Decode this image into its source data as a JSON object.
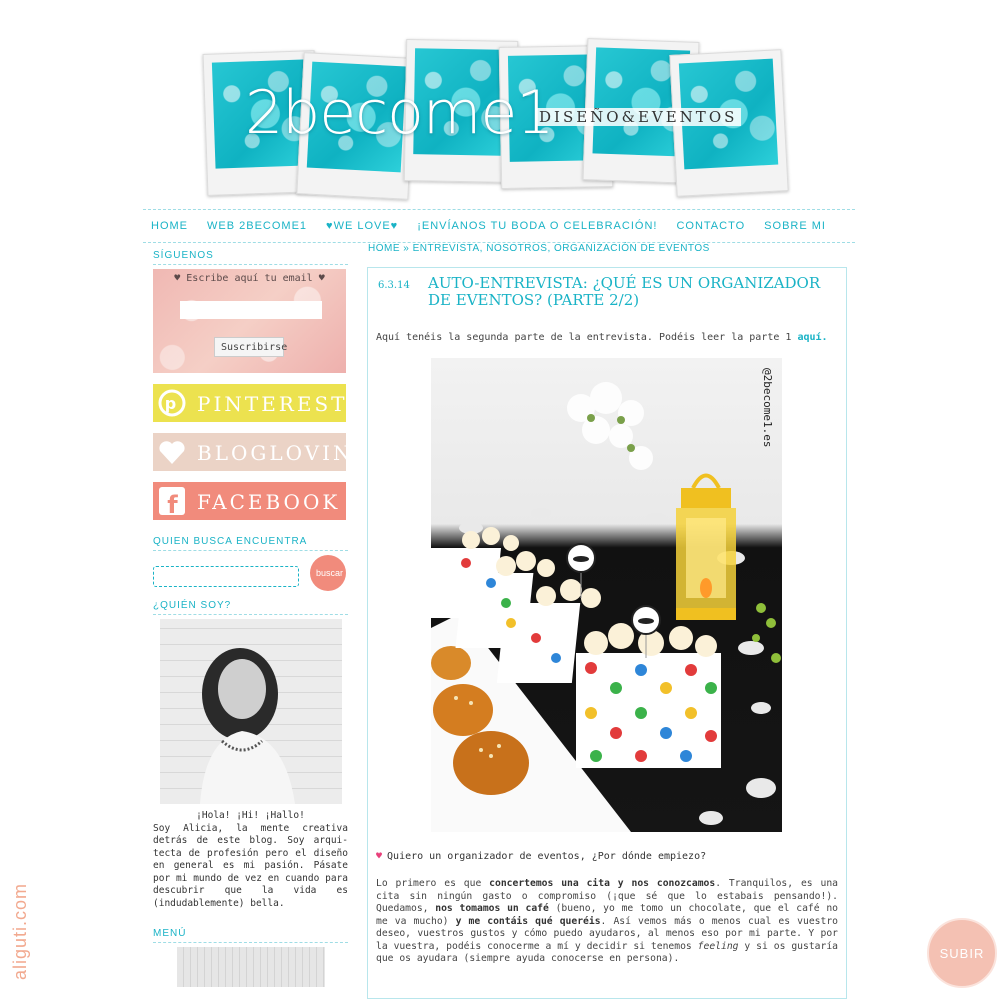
{
  "brand": {
    "logo": "2become1",
    "tagline": "DISEÑO&EVENTOS"
  },
  "nav": [
    {
      "label": "HOME"
    },
    {
      "label": "WEB 2BECOME1"
    },
    {
      "label": "♥WE LOVE♥"
    },
    {
      "label": "¡ENVÍANOS TU BODA O CELEBRACIÓN!"
    },
    {
      "label": "CONTACTO"
    },
    {
      "label": "SOBRE MI"
    }
  ],
  "sidebar": {
    "follow_title": "SÍGUENOS",
    "subscribe_label": "♥ Escribe aquí tu email ♥",
    "subscribe_button": "Suscribirse",
    "social": [
      {
        "label": "PINTEREST",
        "icon": "pinterest-icon",
        "color": "#ece24f"
      },
      {
        "label": "BLOGLOVIN",
        "icon": "heart-icon",
        "color": "#ebd3c6"
      },
      {
        "label": "FACEBOOK",
        "icon": "facebook-icon",
        "color": "#f18b7c"
      }
    ],
    "search_title": "QUIEN BUSCA ENCUENTRA",
    "search_button": "buscar",
    "about_title": "¿QUIÉN SOY?",
    "about_hello": "¡Hola! ¡Hi! ¡Hallo!",
    "about_text": "Soy Alicia, la mente creativa detrás de este blog. Soy arqui-tecta de profesión pero el diseño en general es mi pasión. Pásate por mi mundo de vez en cuando para descubrir que la vida es (indudablemente) bella.",
    "menu_title": "MENÚ"
  },
  "breadcrumb": {
    "home": "HOME",
    "sep": " » ",
    "path": "ENTREVISTA, NOSOTROS, ORGANIZACIÓN DE EVENTOS"
  },
  "post": {
    "date": "6.3.14",
    "title": "AUTO-ENTREVISTA: ¿QUÉ ES UN ORGANIZADOR DE EVENTOS? (PARTE 2/2)",
    "intro_prefix": "Aquí tenéis la segunda parte de la entrevista. Podéis leer la parte 1 ",
    "intro_link": "aquí.",
    "image_watermark": "@2become1.es",
    "question": "Quiero un organizador de eventos, ¿Por dónde empiezo?",
    "body_p1": "Lo primero es que ",
    "body_b1": "concertemos una cita y nos conozcamos",
    "body_p2": ". Tranquilos, es una cita sin ningún gasto o compromiso (¡que sé que lo estabais pensando!). Quedamos, ",
    "body_b2": "nos tomamos un café",
    "body_p3": " (bueno, yo me tomo un chocolate, que el café no me va mucho) ",
    "body_b3": "y me contáis qué queréis",
    "body_p4": ". Así vemos más o menos cual es vuestro deseo, vuestros gustos y cómo puedo ayudaros, al menos eso por mi parte. Y por la vuestra, podéis conocerme a mí y decidir si tenemos ",
    "body_i1": "feeling",
    "body_p5": " y si os gustaría que os ayudara (siempre ayuda conocerse en persona)."
  },
  "side_watermark": "aliguti.com",
  "subir_label": "SUBIR"
}
